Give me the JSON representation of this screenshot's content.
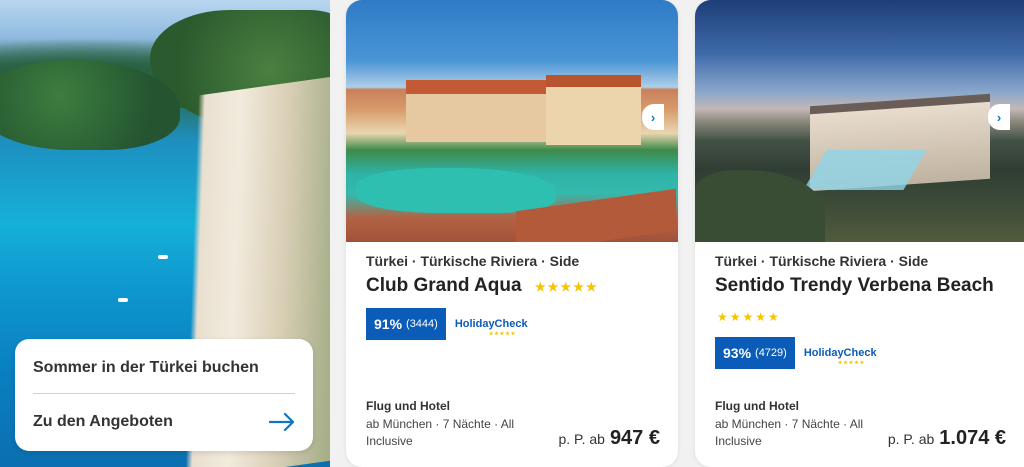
{
  "promo": {
    "title": "Sommer in der Türkei buchen",
    "link_label": "Zu den Angeboten",
    "icon": "arrow-right-icon"
  },
  "hotels": [
    {
      "location": "Türkei · Türkische Riviera · Side",
      "name": "Club Grand Aqua",
      "stars": "★★★★★",
      "star_count": 5,
      "rating_pct": "91%",
      "rating_count": "(3444)",
      "rating_source": "HolidayCheck",
      "offer_type": "Flug und Hotel",
      "offer_detail": "ab München · 7 Nächte · All Inclusive",
      "price_prefix": "p. P. ab",
      "price": "947 €",
      "next_icon": "chevron-right-icon"
    },
    {
      "location": "Türkei · Türkische Riviera · Side",
      "name": "Sentido Trendy Verbena Beach",
      "stars": "★★★★★",
      "star_count": 5,
      "rating_pct": "93%",
      "rating_count": "(4729)",
      "rating_source": "HolidayCheck",
      "offer_type": "Flug und Hotel",
      "offer_detail": "ab München · 7 Nächte · All Inclusive",
      "price_prefix": "p. P. ab",
      "price": "1.074 €",
      "next_icon": "chevron-right-icon"
    }
  ],
  "colors": {
    "accent": "#0a77c2",
    "rating_badge": "#0a5cb8",
    "star": "#f5c400"
  }
}
